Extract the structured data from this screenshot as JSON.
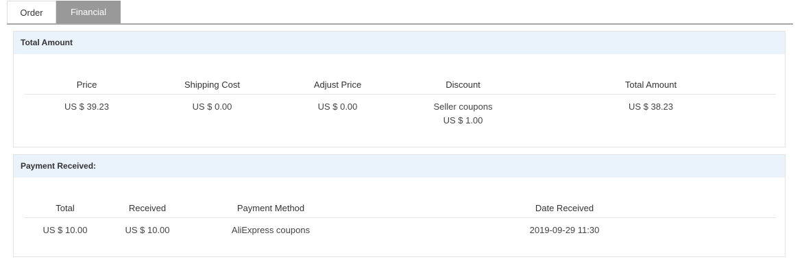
{
  "tabs": [
    {
      "label": "Order"
    },
    {
      "label": "Financial"
    }
  ],
  "total_amount_panel": {
    "title": "Total Amount",
    "headers": [
      "Price",
      "Shipping Cost",
      "Adjust Price",
      "Discount",
      "Total Amount"
    ],
    "row": {
      "price": "US $ 39.23",
      "shipping_cost": "US $ 0.00",
      "adjust_price": "US $ 0.00",
      "discount_type": "Seller coupons",
      "discount_value": "US $ 1.00",
      "total_amount": "US $ 38.23"
    }
  },
  "payment_panel": {
    "title": "Payment Received:",
    "headers": [
      "Total",
      "Received",
      "Payment Method",
      "Date Received"
    ],
    "row": {
      "total": "US $ 10.00",
      "received": "US $ 10.00",
      "payment_method": "AliExpress coupons",
      "date_received": "2019-09-29 11:30"
    }
  }
}
